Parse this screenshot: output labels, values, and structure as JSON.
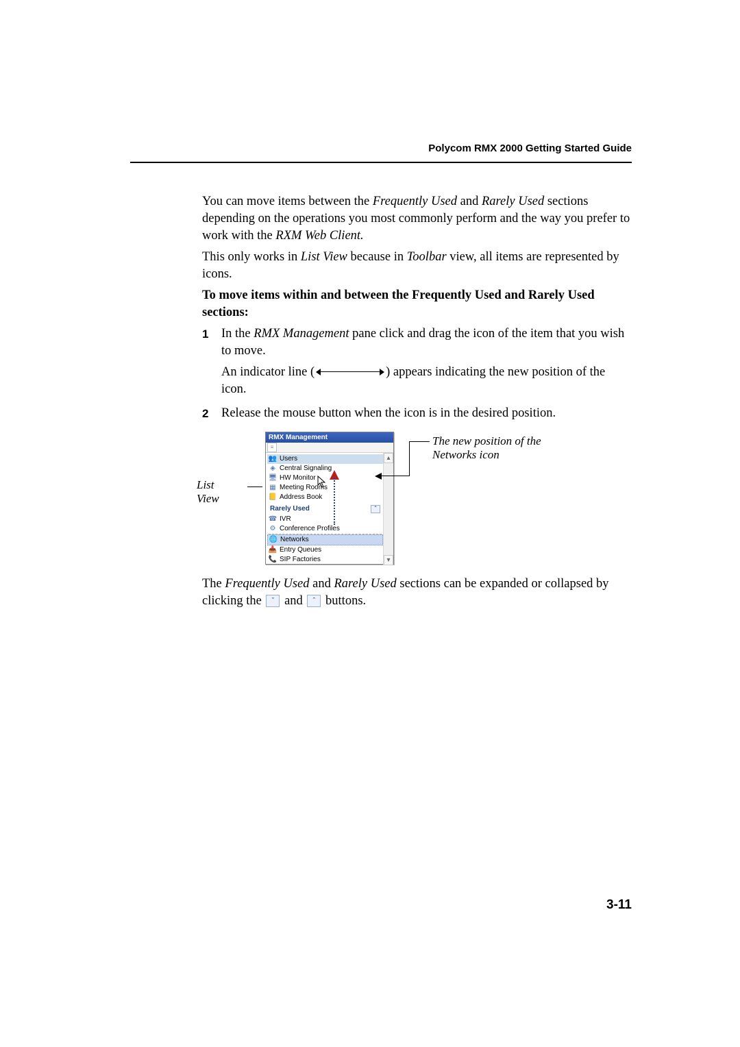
{
  "header": {
    "title": "Polycom RMX 2000 Getting Started Guide"
  },
  "intro": {
    "p1a": "You can move items between the ",
    "p1b": "Frequently Used",
    "p1c": " and ",
    "p1d": "Rarely Used",
    "p1e": " sections depending on the operations you most commonly perform and the way you prefer to work with the ",
    "p1f": "RXM Web Client.",
    "p2a": "This only works in ",
    "p2b": "List View",
    "p2c": " because in ",
    "p2d": "Toolbar",
    "p2e": " view, all items are represented by icons."
  },
  "procedure_title": "To move items within and between the Frequently Used and Rarely Used sections:",
  "steps": {
    "s1num": "1",
    "s1a": "In the ",
    "s1b": "RMX Management",
    "s1c": " pane click and drag the icon of the item that you wish to move.",
    "s1d": "An indicator line (",
    "s1e": ") appears indicating the new position of the icon.",
    "s2num": "2",
    "s2": "Release the mouse button when the icon is in the desired position."
  },
  "figure": {
    "left_label_1": "List",
    "left_label_2": "View",
    "right_label": "The new position of the Networks icon",
    "panel_title": "RMX Management",
    "items_freq": [
      "Users",
      "Central Signaling",
      "HW Monitor",
      "Meeting Rooms",
      "Address Book"
    ],
    "section_rarely": "Rarely Used",
    "items_rare": [
      "IVR",
      "Conference Profiles",
      "Networks",
      "Entry Queues",
      "SIP Factories"
    ]
  },
  "closing": {
    "a": "The ",
    "b": "Frequently Used",
    "c": " and ",
    "d": "Rarely Used",
    "e": " sections can be expanded or collapsed by clicking the ",
    "f": " and ",
    "g": " buttons."
  },
  "page_number": "3-11"
}
